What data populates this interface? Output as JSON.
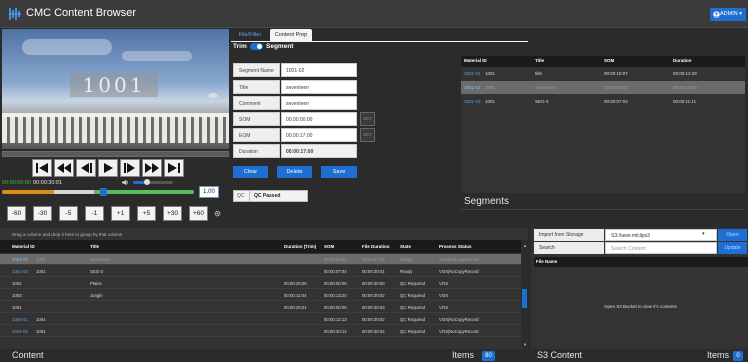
{
  "app": {
    "title": "CMC Content Browser",
    "admin_label": "ADMIN ▾"
  },
  "player": {
    "timecode_overlay": "1001",
    "current_tc": "00:00:00:00",
    "duration_tc": "00:00:30:01",
    "speed_value": "1.00",
    "speed_level_fraction": 0.52,
    "volume_fraction": 0.3,
    "jog_buttons": [
      "-60",
      "-30",
      "-5",
      "-1",
      "+1",
      "+5",
      "+30",
      "+60"
    ]
  },
  "tabs": {
    "file_filter": "File/Filter",
    "content_prep": "Content Prep"
  },
  "prep": {
    "trim_label": "Trim",
    "segment_label": "Segment",
    "fields": [
      {
        "label": "Segment Name",
        "value": "1001-02"
      },
      {
        "label": "Title",
        "value": "seventeen"
      },
      {
        "label": "Comment",
        "value": "seventeen"
      },
      {
        "label": "SOM",
        "value": "00:00:00:00"
      },
      {
        "label": "EOM",
        "value": "00:00:17:00"
      },
      {
        "label": "Duration",
        "value": "00:00:17:00"
      }
    ],
    "set_label": "SET",
    "buttons": {
      "clear": "Clear",
      "delete": "Delete",
      "save": "Save"
    },
    "qc_label": "QC",
    "qc_value": "QC Passed"
  },
  "segments": {
    "title": "Segments",
    "columns": [
      "Material ID",
      "Title",
      "SOM",
      "Duration"
    ],
    "rows": [
      {
        "id": "1001-01",
        "base": "1001",
        "title": "title",
        "som": "00:00:10:07",
        "duration": "00:00:14:29"
      },
      {
        "id": "1001-02",
        "base": "1001",
        "title": "seventeen",
        "som": "00:00:00:00",
        "duration": "00:00:17:00"
      },
      {
        "id": "1001-03",
        "base": "1001",
        "title": "SEG-3",
        "som": "00:00:07:04",
        "duration": "00:00:11:11"
      }
    ]
  },
  "content": {
    "group_hint": "Drag a column and drop it here to group by that column",
    "columns": [
      "Material ID",
      "Title",
      "Duration (Trim)",
      "SOM",
      "File Duration",
      "State",
      "Process Status"
    ],
    "rows": [
      {
        "id": "1001-02",
        "base": "1001",
        "title": "seventeen",
        "dur": "",
        "som": "00:00:00:00",
        "file_dur": "00:00:17:00",
        "state": "Ready",
        "status": "VOS|NoCopyRecord"
      },
      {
        "id": "1001-03",
        "base": "1001",
        "title": "SEG-3",
        "dur": "",
        "som": "00:00:07:04",
        "file_dur": "00:00:30:01",
        "state": "Ready",
        "status": "VOS|NoCopyRecord"
      },
      {
        "id": "1002",
        "base": "",
        "title": "Plains",
        "dur": "00:00:30;00",
        "som": "00:00:00:00",
        "file_dur": "00:00:30:00",
        "state": "QC Required",
        "status": "VOS"
      },
      {
        "id": "1003",
        "base": "",
        "title": "Jungle",
        "dur": "00:00:11:04",
        "som": "00:00:13:20",
        "file_dur": "00:00:30:02",
        "state": "QC Required",
        "status": "VOS"
      },
      {
        "id": "1004",
        "base": "",
        "title": "",
        "dur": "00:00:30;01",
        "som": "00:00:00:00",
        "file_dur": "00:00:30:03",
        "state": "QC Required",
        "status": "VOS"
      },
      {
        "id": "1004-01",
        "base": "1004",
        "title": "",
        "dur": "",
        "som": "00:00:12:13",
        "file_dur": "00:00:30:02",
        "state": "QC Required",
        "status": "VOS|NoCopyRecord"
      },
      {
        "id": "1004-02",
        "base": "1004",
        "title": "",
        "dur": "",
        "som": "00:00:20:12",
        "file_dur": "00:00:30:02",
        "state": "QC Required",
        "status": "VOS|NoCopyRecord"
      }
    ],
    "footer_title": "Content",
    "items_label": "Items",
    "items_count": "80"
  },
  "s3": {
    "import_label": "Import from Storage",
    "import_value": "S3://aws-mlclips3",
    "open_label": "Open",
    "search_label": "Search",
    "search_placeholder": "Search Content",
    "update_label": "Update",
    "file_name_header": "File Name",
    "empty_text": "Open S3 Bucket to view it's contents",
    "footer_title": "S3 Content",
    "items_label": "Items",
    "items_count": "0"
  },
  "colors": {
    "accent": "#1e6fd1",
    "link": "#5aa7e8",
    "timecode_green": "#48b348"
  }
}
